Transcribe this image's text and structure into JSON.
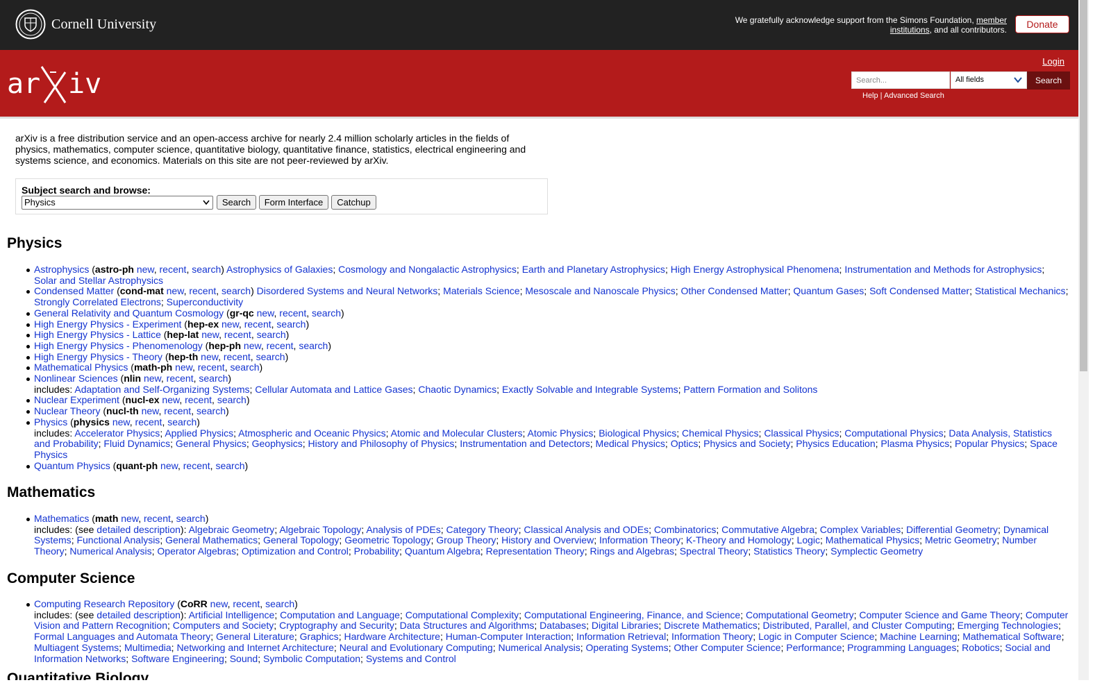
{
  "banner": {
    "university": "Cornell University",
    "support_text": "We gratefully acknowledge support from the Simons Foundation, ",
    "support_link": "member institutions",
    "support_tail": ", and all contributors.",
    "donate": "Donate"
  },
  "header": {
    "login": "Login",
    "search_placeholder": "Search...",
    "field_select": "All fields",
    "search_button": "Search",
    "help": "Help",
    "advanced": "Advanced Search",
    "sep": " | "
  },
  "intro": "arXiv is a free distribution service and an open-access archive for nearly 2.4 million scholarly articles in the fields of physics, mathematics, computer science, quantitative biology, quantitative finance, statistics, electrical engineering and systems science, and economics. Materials on this site are not peer-reviewed by arXiv.",
  "subject": {
    "label": "Subject search and browse:",
    "selected": "Physics",
    "search": "Search",
    "form": "Form Interface",
    "catchup": "Catchup"
  },
  "common": {
    "new": "new",
    "recent": "recent",
    "search": "search",
    "includes": "includes: ",
    "see": "(see ",
    "detailed": "detailed description",
    "close_see": "): "
  },
  "sections": [
    {
      "title": "Physics",
      "items": [
        {
          "name": "Astrophysics",
          "code": "astro-ph",
          "subs": [
            "Astrophysics of Galaxies",
            "Cosmology and Nongalactic Astrophysics",
            "Earth and Planetary Astrophysics",
            "High Energy Astrophysical Phenomena",
            "Instrumentation and Methods for Astrophysics",
            "Solar and Stellar Astrophysics"
          ],
          "inline": true
        },
        {
          "name": "Condensed Matter",
          "code": "cond-mat",
          "subs": [
            "Disordered Systems and Neural Networks",
            "Materials Science",
            "Mesoscale and Nanoscale Physics",
            "Other Condensed Matter",
            "Quantum Gases",
            "Soft Condensed Matter",
            "Statistical Mechanics",
            "Strongly Correlated Electrons",
            "Superconductivity"
          ],
          "inline": true
        },
        {
          "name": "General Relativity and Quantum Cosmology",
          "code": "gr-qc",
          "subs": []
        },
        {
          "name": "High Energy Physics - Experiment",
          "code": "hep-ex",
          "subs": []
        },
        {
          "name": "High Energy Physics - Lattice",
          "code": "hep-lat",
          "subs": []
        },
        {
          "name": "High Energy Physics - Phenomenology",
          "code": "hep-ph",
          "subs": []
        },
        {
          "name": "High Energy Physics - Theory",
          "code": "hep-th",
          "subs": []
        },
        {
          "name": "Mathematical Physics",
          "code": "math-ph",
          "subs": []
        },
        {
          "name": "Nonlinear Sciences",
          "code": "nlin",
          "subs": [
            "Adaptation and Self-Organizing Systems",
            "Cellular Automata and Lattice Gases",
            "Chaotic Dynamics",
            "Exactly Solvable and Integrable Systems",
            "Pattern Formation and Solitons"
          ],
          "includes": true
        },
        {
          "name": "Nuclear Experiment",
          "code": "nucl-ex",
          "subs": []
        },
        {
          "name": "Nuclear Theory",
          "code": "nucl-th",
          "subs": []
        },
        {
          "name": "Physics",
          "code": "physics",
          "subs": [
            "Accelerator Physics",
            "Applied Physics",
            "Atmospheric and Oceanic Physics",
            "Atomic and Molecular Clusters",
            "Atomic Physics",
            "Biological Physics",
            "Chemical Physics",
            "Classical Physics",
            "Computational Physics",
            "Data Analysis, Statistics and Probability",
            "Fluid Dynamics",
            "General Physics",
            "Geophysics",
            "History and Philosophy of Physics",
            "Instrumentation and Detectors",
            "Medical Physics",
            "Optics",
            "Physics and Society",
            "Physics Education",
            "Plasma Physics",
            "Popular Physics",
            "Space Physics"
          ],
          "includes": true
        },
        {
          "name": "Quantum Physics",
          "code": "quant-ph",
          "subs": []
        }
      ]
    },
    {
      "title": "Mathematics",
      "items": [
        {
          "name": "Mathematics",
          "code": "math",
          "subs": [
            "Algebraic Geometry",
            "Algebraic Topology",
            "Analysis of PDEs",
            "Category Theory",
            "Classical Analysis and ODEs",
            "Combinatorics",
            "Commutative Algebra",
            "Complex Variables",
            "Differential Geometry",
            "Dynamical Systems",
            "Functional Analysis",
            "General Mathematics",
            "General Topology",
            "Geometric Topology",
            "Group Theory",
            "History and Overview",
            "Information Theory",
            "K-Theory and Homology",
            "Logic",
            "Mathematical Physics",
            "Metric Geometry",
            "Number Theory",
            "Numerical Analysis",
            "Operator Algebras",
            "Optimization and Control",
            "Probability",
            "Quantum Algebra",
            "Representation Theory",
            "Rings and Algebras",
            "Spectral Theory",
            "Statistics Theory",
            "Symplectic Geometry"
          ],
          "includes": true,
          "detailed": true
        }
      ]
    },
    {
      "title": "Computer Science",
      "items": [
        {
          "name": "Computing Research Repository",
          "code": "CoRR",
          "subs": [
            "Artificial Intelligence",
            "Computation and Language",
            "Computational Complexity",
            "Computational Engineering, Finance, and Science",
            "Computational Geometry",
            "Computer Science and Game Theory",
            "Computer Vision and Pattern Recognition",
            "Computers and Society",
            "Cryptography and Security",
            "Data Structures and Algorithms",
            "Databases",
            "Digital Libraries",
            "Discrete Mathematics",
            "Distributed, Parallel, and Cluster Computing",
            "Emerging Technologies",
            "Formal Languages and Automata Theory",
            "General Literature",
            "Graphics",
            "Hardware Architecture",
            "Human-Computer Interaction",
            "Information Retrieval",
            "Information Theory",
            "Logic in Computer Science",
            "Machine Learning",
            "Mathematical Software",
            "Multiagent Systems",
            "Multimedia",
            "Networking and Internet Architecture",
            "Neural and Evolutionary Computing",
            "Numerical Analysis",
            "Operating Systems",
            "Other Computer Science",
            "Performance",
            "Programming Languages",
            "Robotics",
            "Social and Information Networks",
            "Software Engineering",
            "Sound",
            "Symbolic Computation",
            "Systems and Control"
          ],
          "includes": true,
          "detailed": true
        }
      ]
    }
  ],
  "next_section": "Quantitative Biology"
}
